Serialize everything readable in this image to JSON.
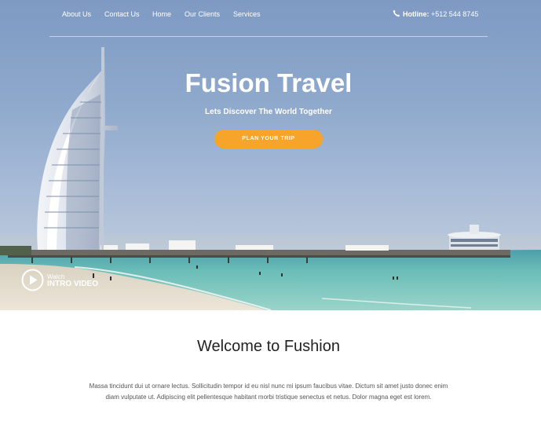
{
  "nav": {
    "links": [
      "About Us",
      "Contact Us",
      "Home",
      "Our Clients",
      "Services"
    ],
    "hotline_label": "Hotline:",
    "hotline_number": "+512 544 8745",
    "phone_icon": "phone-icon"
  },
  "hero": {
    "title": "Fusion Travel",
    "subtitle": "Lets Discover The World Together",
    "cta_label": "PLAN YOUR TRIP",
    "video_watch": "Watch",
    "video_label": "INTRO VIDEO",
    "play_icon": "play-circle-icon"
  },
  "welcome": {
    "title": "Welcome to Fushion",
    "body": "Massa tincidunt dui ut ornare lectus. Sollicitudin tempor id eu nisl nunc mi ipsum faucibus vitae. Dictum sit amet justo donec enim diam vulputate ut. Adipiscing elit pellentesque habitant morbi tristique senectus et netus. Dolor magna eget est lorem."
  },
  "colors": {
    "accent": "#f6a52a",
    "sky": "#8aa5cb",
    "sea": "#5fb3b3",
    "sand": "#e4dccb",
    "text_dark": "#222222",
    "text_body": "#555555"
  }
}
